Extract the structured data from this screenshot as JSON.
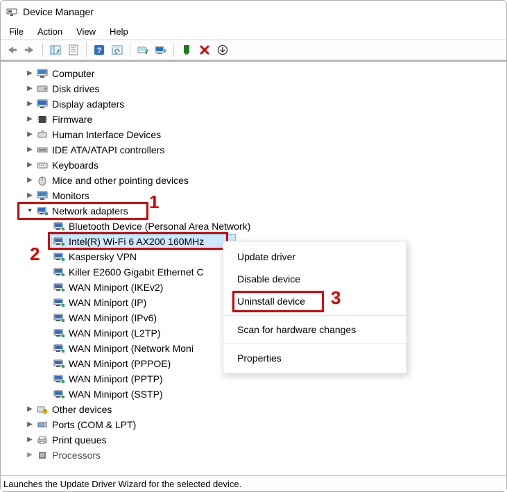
{
  "window": {
    "title": "Device Manager"
  },
  "menu": {
    "file": "File",
    "action": "Action",
    "view": "View",
    "help": "Help"
  },
  "toolbar_icons": [
    "back-arrow-icon",
    "forward-arrow-icon",
    "|",
    "show-hide-tree-icon",
    "properties-icon",
    "|",
    "help-icon",
    "refresh-icon",
    "|",
    "update-driver-icon",
    "scan-hardware-icon",
    "|",
    "enable-device-icon",
    "uninstall-x-icon",
    "download-icon"
  ],
  "tree": {
    "top": [
      {
        "label": "Computer",
        "icon": "monitor"
      },
      {
        "label": "Disk drives",
        "icon": "disk"
      },
      {
        "label": "Display adapters",
        "icon": "display"
      },
      {
        "label": "Firmware",
        "icon": "chip"
      },
      {
        "label": "Human Interface Devices",
        "icon": "hid"
      },
      {
        "label": "IDE ATA/ATAPI controllers",
        "icon": "ide"
      },
      {
        "label": "Keyboards",
        "icon": "keyboard"
      },
      {
        "label": "Mice and other pointing devices",
        "icon": "mouse"
      },
      {
        "label": "Monitors",
        "icon": "monitor"
      }
    ],
    "network": {
      "label": "Network adapters",
      "children": [
        "Bluetooth Device (Personal Area Network)",
        "Intel(R) Wi-Fi 6 AX200 160MHz",
        "Kaspersky VPN",
        "Killer E2600 Gigabit Ethernet C",
        "WAN Miniport (IKEv2)",
        "WAN Miniport (IP)",
        "WAN Miniport (IPv6)",
        "WAN Miniport (L2TP)",
        "WAN Miniport (Network Moni",
        "WAN Miniport (PPPOE)",
        "WAN Miniport (PPTP)",
        "WAN Miniport (SSTP)"
      ],
      "selected_index": 1
    },
    "bottom": [
      {
        "label": "Other devices",
        "icon": "other"
      },
      {
        "label": "Ports (COM & LPT)",
        "icon": "port"
      },
      {
        "label": "Print queues",
        "icon": "printer"
      },
      {
        "label": "Processors",
        "icon": "cpu"
      }
    ]
  },
  "context_menu": {
    "update": "Update driver",
    "disable": "Disable device",
    "uninstall": "Uninstall device",
    "scan": "Scan for hardware changes",
    "properties": "Properties"
  },
  "annotations": {
    "n1": "1",
    "n2": "2",
    "n3": "3"
  },
  "statusbar": "Launches the Update Driver Wizard for the selected device."
}
